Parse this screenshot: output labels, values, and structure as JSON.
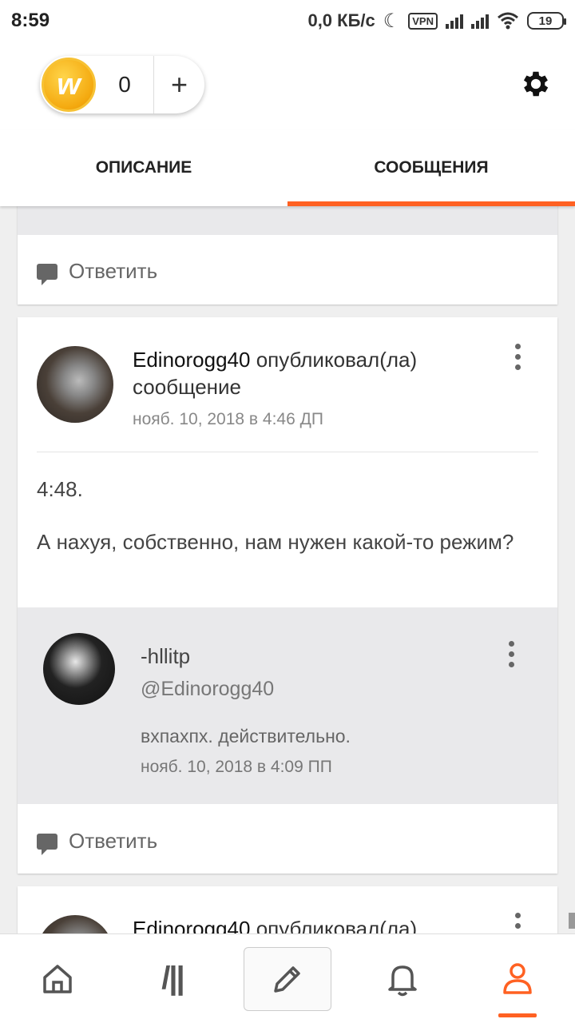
{
  "status_bar": {
    "time": "8:59",
    "network_speed": "0,0 КБ/с",
    "vpn_label": "VPN",
    "battery": "19"
  },
  "header": {
    "coin_count": "0",
    "coin_letter": "w",
    "plus_label": "+"
  },
  "tabs": [
    {
      "label": "ОПИСАНИЕ",
      "active": false
    },
    {
      "label": "СООБЩЕНИЯ",
      "active": true
    }
  ],
  "posts": [
    {
      "reply_label": "Ответить"
    },
    {
      "author": "Edinorogg40",
      "action": "опубликовал(ла)",
      "action_line2": "сообщение",
      "date": "нояб. 10, 2018 в 4:46 ДП",
      "message_line1": "4:48.",
      "message_line2": "А нахуя,  собственно,  нам нужен какой-то режим?",
      "reply": {
        "author": "-hllitp",
        "mention": "@Edinorogg40",
        "text": "вхпахпх. действительно.",
        "date": "нояб. 10, 2018 в 4:09 ПП"
      },
      "reply_label": "Ответить"
    },
    {
      "author": "Edinorogg40",
      "action": "опубликовал(ла)"
    }
  ],
  "bottom_nav": {
    "library_label": "/||",
    "active": "profile",
    "accent_color": "#ff6122"
  }
}
